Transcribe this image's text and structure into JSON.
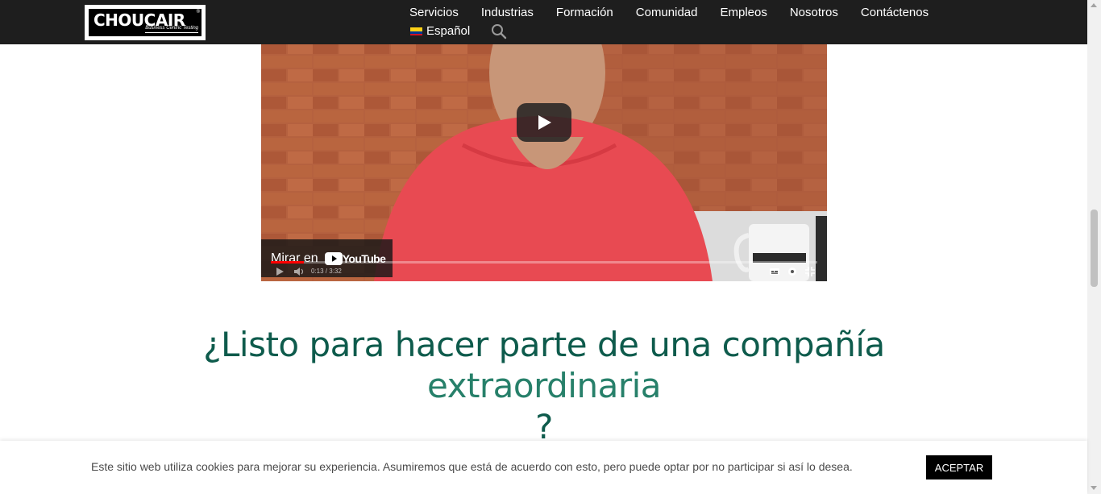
{
  "header": {
    "logo_text": "CHOUCAIR",
    "logo_tagline": "Business Centric Testing",
    "nav": [
      "Servicios",
      "Industrias",
      "Formación",
      "Comunidad",
      "Empleos",
      "Nosotros",
      "Contáctenos"
    ],
    "language": "Español",
    "icons": {
      "search": "search-icon",
      "flag": "colombia-flag-icon"
    }
  },
  "video": {
    "watch_label": "Mirar en",
    "brand": "YouTube",
    "time": "0:13 / 3:32",
    "progress": 0.06,
    "icons": [
      "play-icon",
      "volume-icon",
      "subtitles-icon",
      "settings-icon",
      "fullscreen-exit-icon"
    ]
  },
  "cta": {
    "heading_main": "¿Listo para hacer parte de una compañía ",
    "heading_accent": "extraordinaria",
    "heading_end": "?"
  },
  "cookie": {
    "text": "Este sitio web utiliza cookies para mejorar su experiencia. Asumiremos que está de acuerdo con esto, pero puede optar por no participar si así lo desea.",
    "accept_label": "ACEPTAR"
  },
  "colors": {
    "heading": "#0e5b4c",
    "accent": "#27806a",
    "header_bg": "#1e1e1e"
  }
}
